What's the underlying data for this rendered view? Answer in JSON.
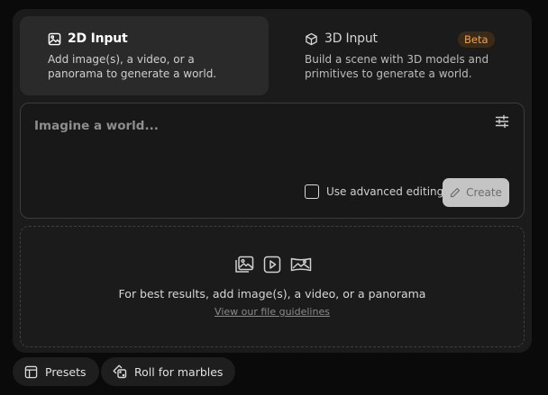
{
  "modes": [
    {
      "title": "2D Input",
      "description": "Add image(s), a video, or a panorama to generate a world.",
      "icon": "image-icon",
      "active": true
    },
    {
      "title": "3D Input",
      "description": "Build a scene with 3D models and primitives to generate a world.",
      "icon": "cube-icon",
      "badge": "Beta",
      "active": false
    }
  ],
  "prompt": {
    "placeholder": "Imagine a world...",
    "advanced_label": "Use advanced editing",
    "create_label": "Create"
  },
  "drop_zone": {
    "text": "For best results, add image(s), a video, or a panorama",
    "link": "View our file guidelines",
    "icons": [
      "image-icon",
      "video-icon",
      "panorama-icon"
    ]
  },
  "footer": {
    "presets_label": "Presets",
    "roll_label": "Roll for marbles"
  },
  "colors": {
    "accent_badge": "#f2a04a",
    "create_bg": "#c4c4c4"
  }
}
